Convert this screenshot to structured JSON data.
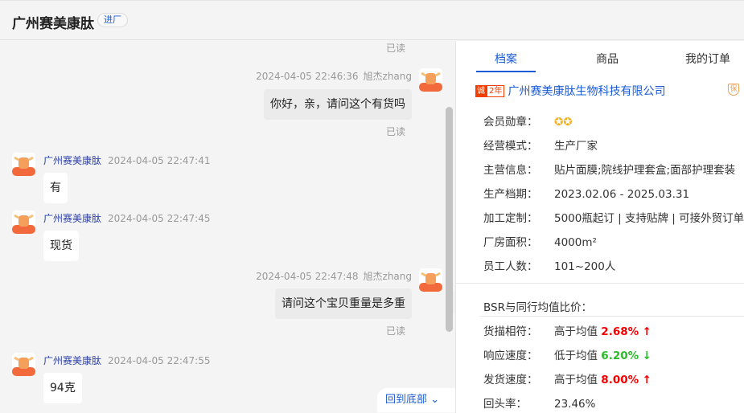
{
  "header": {
    "title": "广州赛美康肽",
    "badge": "进厂"
  },
  "chat": {
    "top_read": "已读",
    "messages": [
      {
        "time": "2024-04-05 22:46:36",
        "sender": "旭杰zhang",
        "text": "你好，亲，请问这个有货吗",
        "status": "已读"
      },
      {
        "time": "2024-04-05 22:47:41",
        "sender": "广州赛美康肽",
        "text": "有"
      },
      {
        "time": "2024-04-05 22:47:45",
        "sender": "广州赛美康肽",
        "text": "现货"
      },
      {
        "time": "2024-04-05 22:47:48",
        "sender": "旭杰zhang",
        "text": "请问这个宝贝重量是多重",
        "status": "已读"
      },
      {
        "time": "2024-04-05 22:47:55",
        "sender": "广州赛美康肽",
        "text": "94克"
      }
    ],
    "back_to_bottom": "回到底部"
  },
  "panel": {
    "tabs": [
      "档案",
      "商品",
      "我的订单"
    ],
    "company": {
      "years": "2年",
      "name": "广州赛美康肽生物科技有限公司"
    },
    "rows": [
      {
        "label": "会员勋章：",
        "value": ""
      },
      {
        "label": "经营模式：",
        "value": "生产厂家"
      },
      {
        "label": "主营信息：",
        "value": "贴片面膜;院线护理套盒;面部护理套装"
      },
      {
        "label": "生产档期：",
        "value": "2023.02.06 - 2025.03.31"
      },
      {
        "label": "加工定制：",
        "value": "5000瓶起订 | 支持贴牌 | 可接外贸订单"
      },
      {
        "label": "厂房面积：",
        "value": "4000m²"
      },
      {
        "label": "员工人数：",
        "value": "101~200人"
      }
    ],
    "bsr_title": "BSR与同行均值比价：",
    "bsr": [
      {
        "label": "货描相符：",
        "desc": "高于均值",
        "pct": "2.68%",
        "arrow": "↑"
      },
      {
        "label": "响应速度：",
        "desc": "低于均值",
        "pct": "6.20%",
        "arrow": "↓"
      },
      {
        "label": "发货速度：",
        "desc": "高于均值",
        "pct": "8.00%",
        "arrow": "↑"
      }
    ],
    "repeat": {
      "label": "回头率：",
      "value": "23.46%"
    }
  }
}
